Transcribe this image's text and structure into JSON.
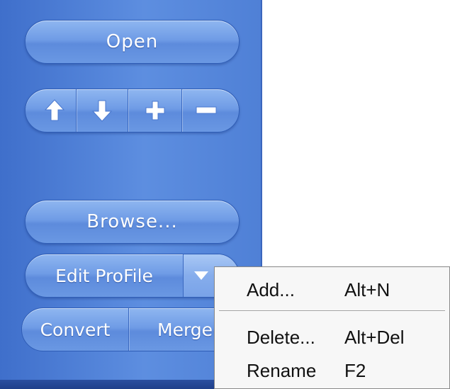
{
  "panel": {
    "open_label": "Open",
    "browse_label": "Browse...",
    "edit_profile_label": "Edit ProFile",
    "convert_label": "Convert",
    "merge_label": "Merge"
  },
  "toolbar_icons": [
    "arrow-up-icon",
    "arrow-down-icon",
    "plus-icon",
    "minus-icon"
  ],
  "context_menu": {
    "items": [
      {
        "label": "Add...",
        "shortcut": "Alt+N"
      },
      {
        "label": "Delete...",
        "shortcut": "Alt+Del"
      },
      {
        "label": "Rename",
        "shortcut": "F2"
      }
    ]
  },
  "colors": {
    "panel_blue": "#4f80d6",
    "button_border": "#2f5db6",
    "menu_background": "#f7f7f7"
  }
}
